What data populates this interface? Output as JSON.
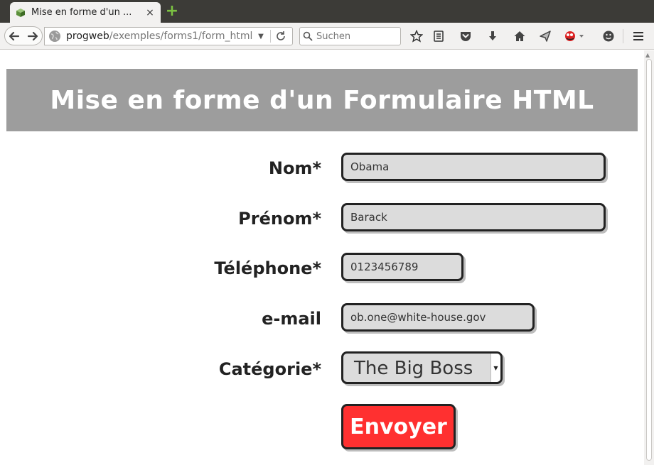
{
  "browser": {
    "tab_title": "Mise en forme d'un ...",
    "tab_close": "×",
    "new_tab": "+",
    "url_host": "progweb",
    "url_path": "/exemples/forms1/form_html",
    "search_placeholder": "Suchen"
  },
  "page": {
    "heading": "Mise en forme d'un Formulaire HTML",
    "fields": {
      "nom": {
        "label": "Nom*",
        "value": "Obama"
      },
      "prenom": {
        "label": "Prénom*",
        "value": "Barack"
      },
      "telephone": {
        "label": "Téléphone*",
        "value": "0123456789"
      },
      "email": {
        "label": "e-mail",
        "value": "ob.one@white-house.gov"
      },
      "categorie": {
        "label": "Catégorie*",
        "value": "The Big Boss"
      }
    },
    "submit_label": "Envoyer"
  },
  "colors": {
    "banner": "#9d9d9d",
    "field_bg": "#dcdcdc",
    "submit_bg": "#ff3030"
  },
  "icons": [
    "favicon-icon",
    "plus-icon",
    "back-icon",
    "forward-icon",
    "globe-icon",
    "dropdown-icon",
    "reload-icon",
    "search-icon",
    "bookmark-star-icon",
    "reading-list-icon",
    "pocket-icon",
    "download-icon",
    "home-icon",
    "send-icon",
    "extension-icon",
    "smiley-icon",
    "menu-icon"
  ]
}
